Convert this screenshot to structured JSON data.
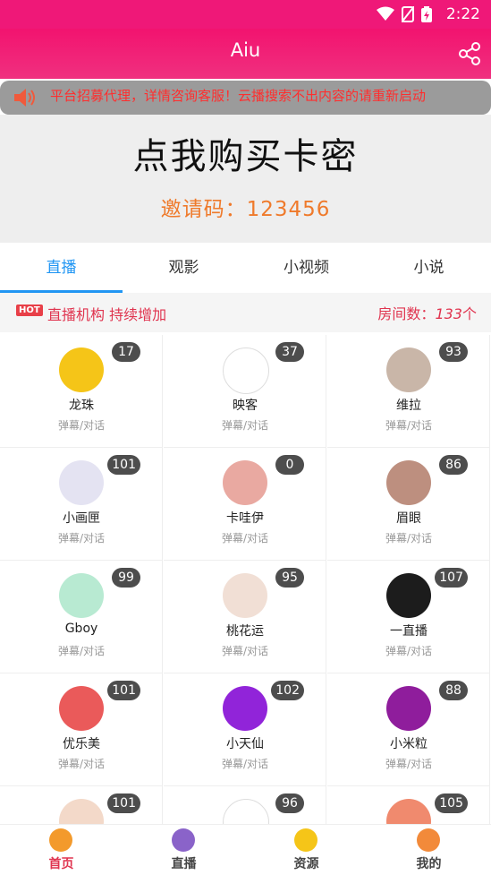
{
  "status": {
    "time": "2:22"
  },
  "app": {
    "title": "Aiu",
    "share_icon": "share-icon"
  },
  "notice": {
    "text": "平台招募代理，详情咨询客服！云播搜索不出内容的请重新启动"
  },
  "banner": {
    "headline": "点我购买卡密",
    "invite": "邀请码：123456"
  },
  "tabs": [
    {
      "label": "直播",
      "active": true
    },
    {
      "label": "观影",
      "active": false
    },
    {
      "label": "小视频",
      "active": false
    },
    {
      "label": "小说",
      "active": false
    }
  ],
  "info": {
    "hot": "HOT",
    "agency": "直播机构 持续增加",
    "rooms_label": "房间数：",
    "rooms_count": "133",
    "rooms_unit": "个"
  },
  "platforms": [
    {
      "name": "龙珠",
      "sub": "弹幕/对话",
      "count": "17",
      "color": "#f5c518"
    },
    {
      "name": "映客",
      "sub": "弹幕/对话",
      "count": "37",
      "color": "#ffffff"
    },
    {
      "name": "维拉",
      "sub": "弹幕/对话",
      "count": "93",
      "color": "#c9b6a8"
    },
    {
      "name": "小画匣",
      "sub": "弹幕/对话",
      "count": "101",
      "color": "#e4e3f2"
    },
    {
      "name": "卡哇伊",
      "sub": "弹幕/对话",
      "count": "0",
      "color": "#e9a9a1"
    },
    {
      "name": "眉眼",
      "sub": "弹幕/对话",
      "count": "86",
      "color": "#bd8f7f"
    },
    {
      "name": "Gboy",
      "sub": "弹幕/对话",
      "count": "99",
      "color": "#b8ead2"
    },
    {
      "name": "桃花运",
      "sub": "弹幕/对话",
      "count": "95",
      "color": "#f1dfd5"
    },
    {
      "name": "一直播",
      "sub": "弹幕/对话",
      "count": "107",
      "color": "#1c1c1c"
    },
    {
      "name": "优乐美",
      "sub": "弹幕/对话",
      "count": "101",
      "color": "#ea5a5a"
    },
    {
      "name": "小天仙",
      "sub": "弹幕/对话",
      "count": "102",
      "color": "#9124d9"
    },
    {
      "name": "小米粒",
      "sub": "弹幕/对话",
      "count": "88",
      "color": "#8f1d9c"
    },
    {
      "name": "",
      "sub": "",
      "count": "101",
      "color": "#f3d9c9"
    },
    {
      "name": "",
      "sub": "",
      "count": "96",
      "color": "#ffffff"
    },
    {
      "name": "",
      "sub": "",
      "count": "105",
      "color": "#f08a6e"
    }
  ],
  "nav": [
    {
      "label": "首页",
      "icon": "home-icon",
      "active": true,
      "color": "#f39a2c"
    },
    {
      "label": "直播",
      "icon": "live-icon",
      "active": false,
      "color": "#8a63c9"
    },
    {
      "label": "资源",
      "icon": "planet-icon",
      "active": false,
      "color": "#f5c518"
    },
    {
      "label": "我的",
      "icon": "profile-icon",
      "active": false,
      "color": "#f28a3a"
    }
  ]
}
